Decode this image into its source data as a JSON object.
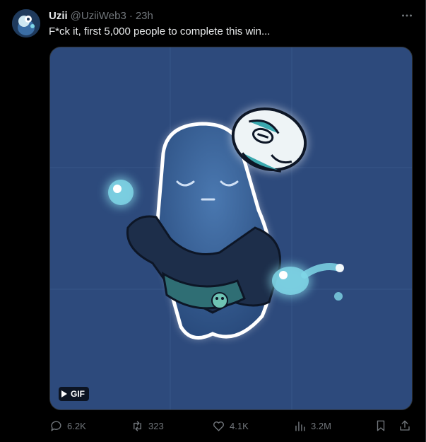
{
  "tweet": {
    "author_name": "Uzii",
    "author_handle": "@UziiWeb3",
    "separator": "·",
    "time": "23h",
    "text": "F*ck it, first 5,000 people to complete this win...",
    "media": {
      "badge_label": "GIF",
      "badge_icon": "play-icon",
      "background_color": "#2d4a7c"
    }
  },
  "actions": {
    "reply_count": "6.2K",
    "retweet_count": "323",
    "like_count": "4.1K",
    "views_count": "3.2M"
  },
  "icons": {
    "reply": "reply-icon",
    "retweet": "retweet-icon",
    "like": "heart-icon",
    "views": "views-icon",
    "bookmark": "bookmark-icon",
    "share": "share-icon",
    "more": "more-icon"
  },
  "colors": {
    "background": "#000000",
    "primary_text": "#e7e9ea",
    "secondary_text": "#71767b",
    "border": "#2f3336"
  }
}
